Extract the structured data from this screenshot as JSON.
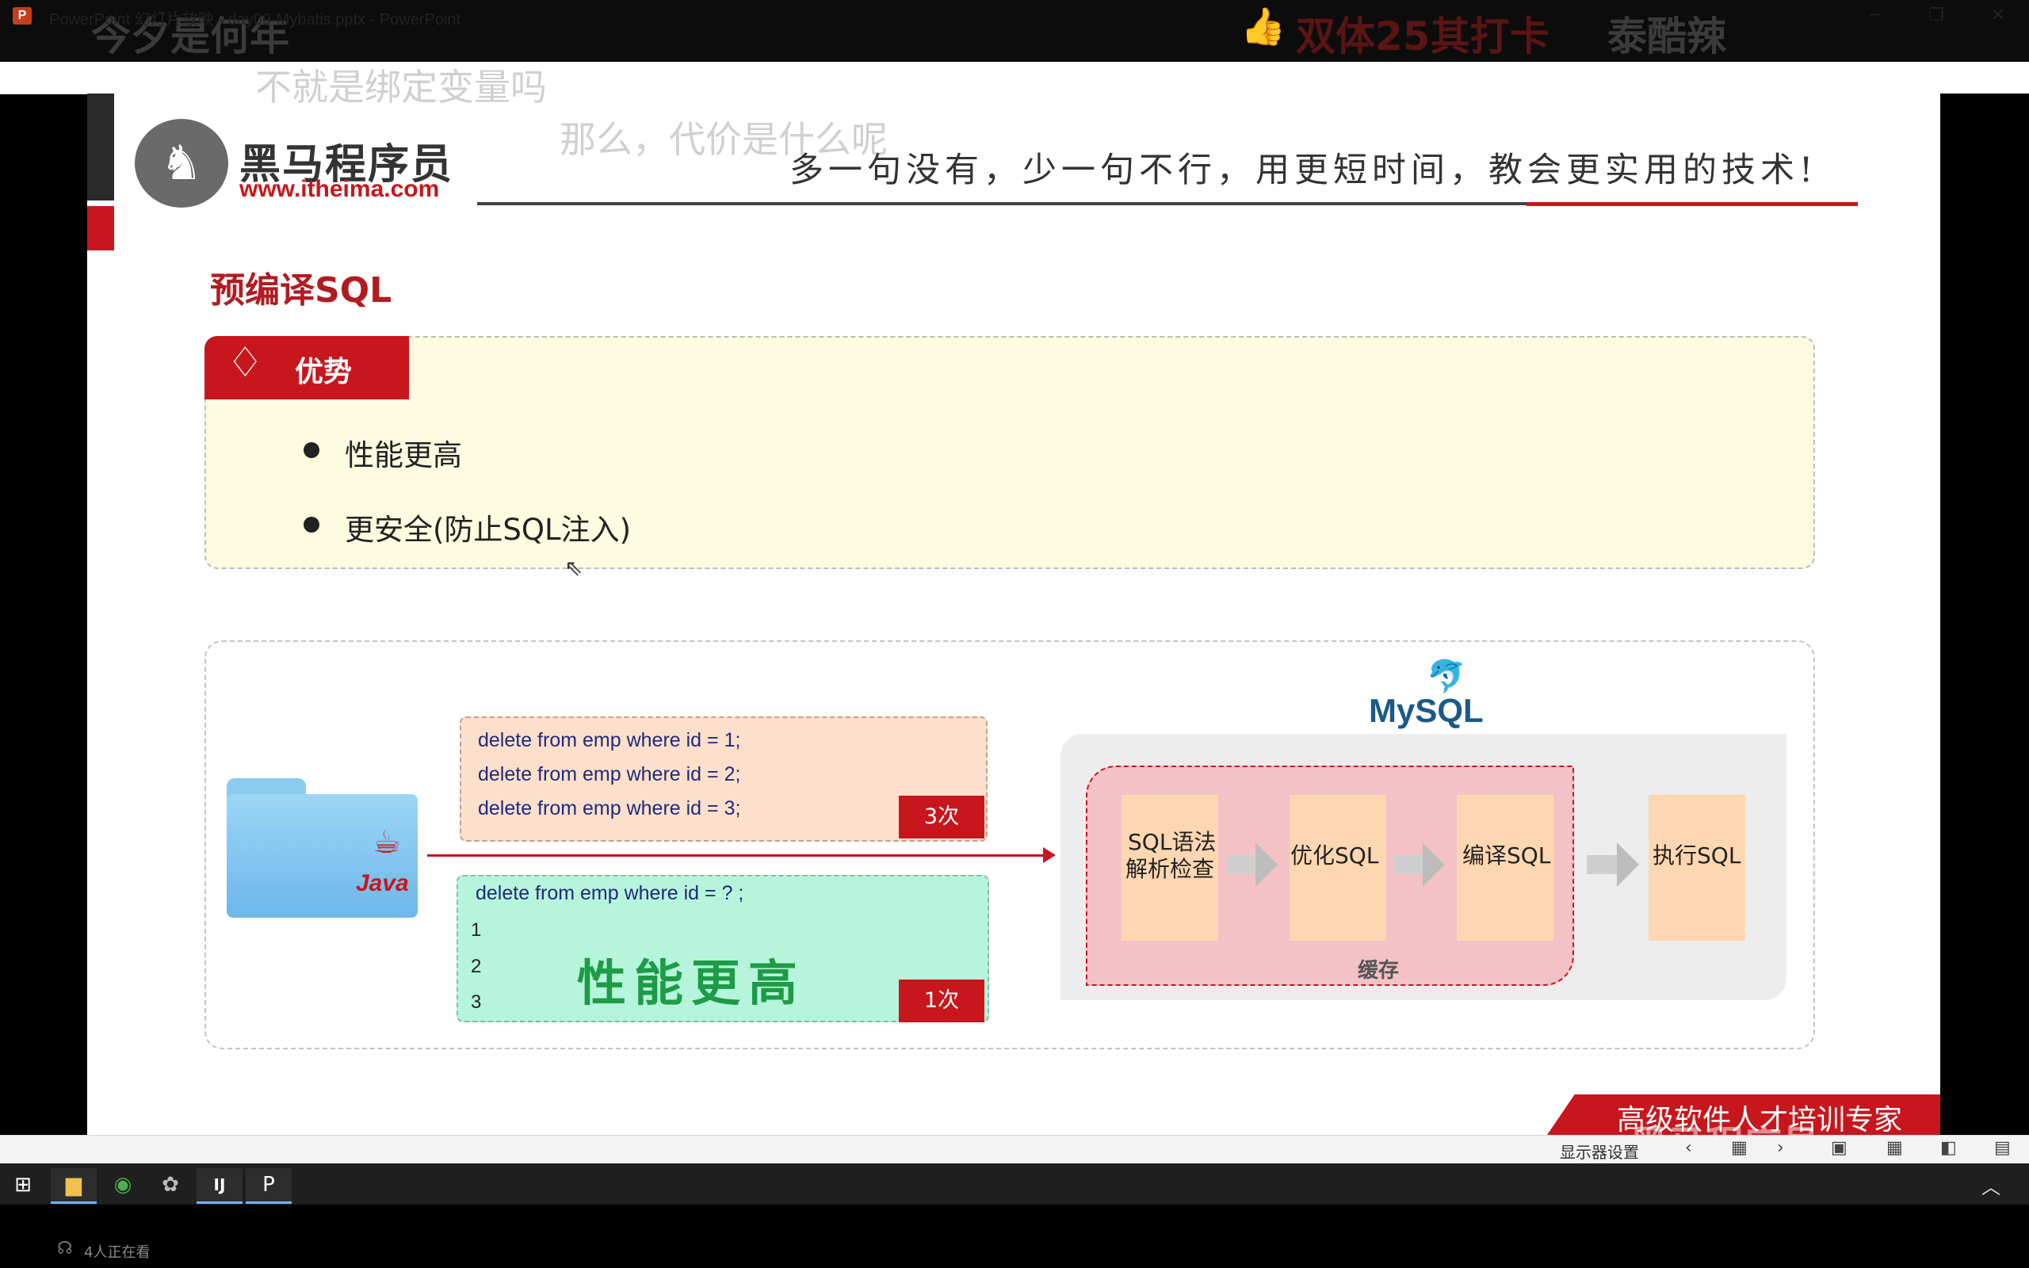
{
  "overlay": {
    "title": "今夕是何年",
    "like_icon": "👍",
    "punch": "双体25其打卡",
    "user": "泰酷辣",
    "subtitle1": "不就是绑定变量吗",
    "subtitle2": "那么，代价是什么呢"
  },
  "window": {
    "app_icon": "P",
    "title": "PowerPoint 幻灯片放映  -  day09-Mybatis.pptx - PowerPoint",
    "minimize": "─",
    "maximize": "❐",
    "close": "✕"
  },
  "slide": {
    "logo_icon": "♞",
    "logo_cn": "黑马程序员",
    "logo_url": "www.itheima.com",
    "slogan": "多一句没有，少一句不行，用更短时间，教会更实用的技术!",
    "heading": "预编译SQL",
    "advantages": {
      "icon": "♢",
      "title": "优势",
      "items": [
        "性能更高",
        "更安全(防止SQL注入)"
      ]
    },
    "diagram": {
      "java_cup": "☕",
      "java_label": "Java",
      "statements_a": [
        "delete from emp where id = 1;",
        "delete from emp where id = 2;",
        "delete from emp where id = 3;"
      ],
      "count_a": "3次",
      "statement_b": "delete from emp where id = ? ;",
      "params_b": [
        "1",
        "2",
        "3"
      ],
      "perf_label": "性能更高",
      "count_b": "1次",
      "mysql_dolphin": "🐬",
      "mysql_logo": "MySQL",
      "steps": [
        "SQL语法",
        "解析检查",
        "优化SQL",
        "编译SQL",
        "执行SQL"
      ],
      "cache_label": "缓存"
    },
    "footer_slogan": "高级软件人才培训专家",
    "watermark": "黑马程序员"
  },
  "statusbar": {
    "display_settings": "显示器设置",
    "icons": [
      "‹",
      "▦",
      "›",
      "▣",
      "▦",
      "◧",
      "▤"
    ]
  },
  "taskbar": {
    "start": "⊞",
    "explorer": "▆",
    "chrome": "◉",
    "app": "✿",
    "idea": "IJ",
    "ppt": "P",
    "tray": "︿"
  },
  "viewer": {
    "icon": "☊",
    "text": "4人正在看"
  }
}
